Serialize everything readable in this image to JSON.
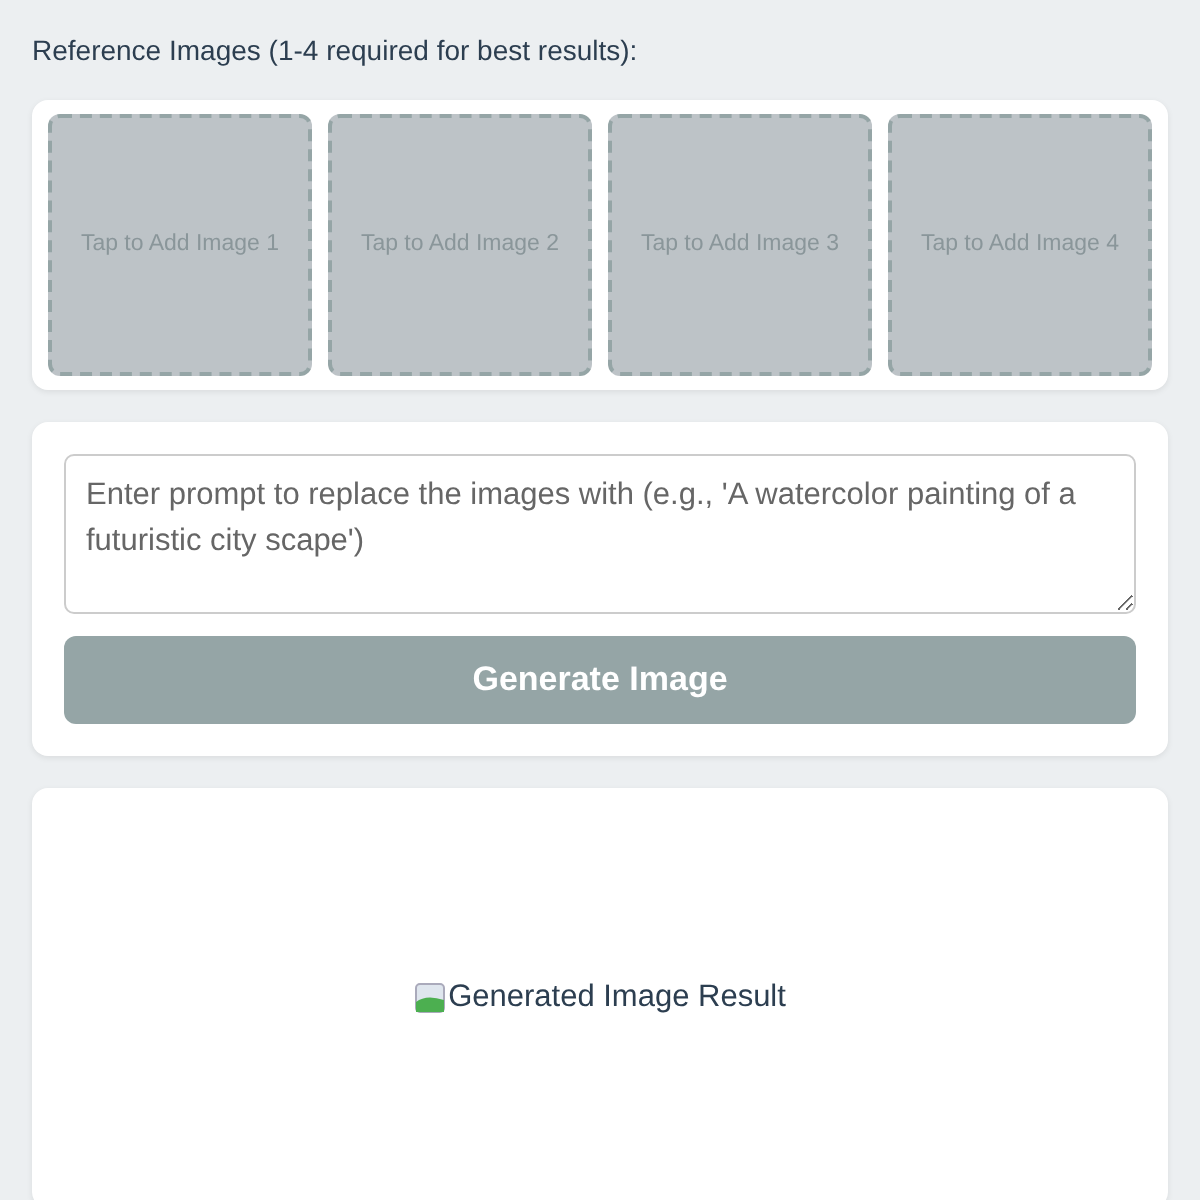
{
  "reference_label": "Reference Images (1-4 required for best results):",
  "image_slots": [
    {
      "label": "Tap to Add Image 1"
    },
    {
      "label": "Tap to Add Image 2"
    },
    {
      "label": "Tap to Add Image 3"
    },
    {
      "label": "Tap to Add Image 4"
    }
  ],
  "prompt": {
    "placeholder": "Enter prompt to replace the images with (e.g., 'A watercolor painting of a futuristic city scape')"
  },
  "generate_button": {
    "label": "Generate Image",
    "disabled": true
  },
  "result": {
    "alt_text": "Generated Image Result"
  }
}
